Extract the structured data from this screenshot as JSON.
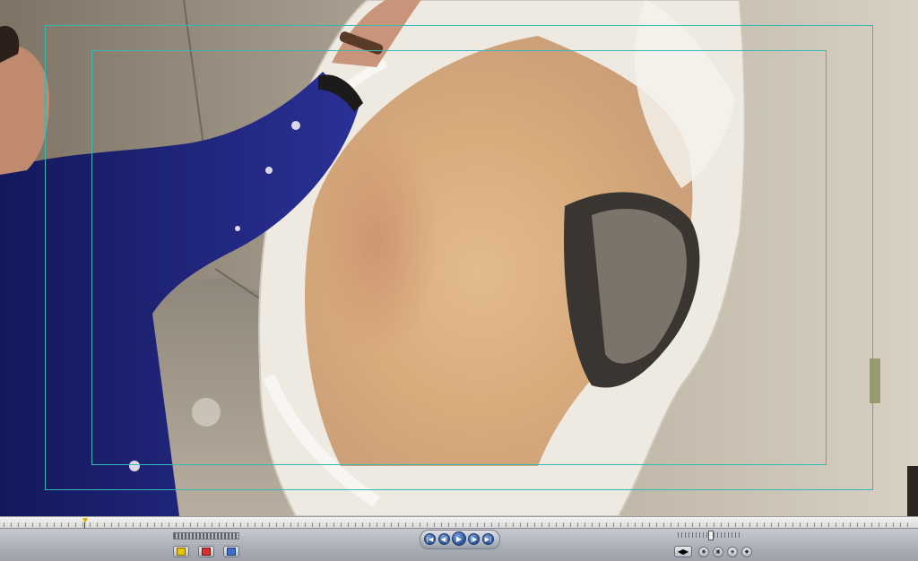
{
  "viewer": {
    "overlay": "title-action-safe"
  },
  "colors": {
    "safe_overlay": "#36b8b4",
    "playhead": "#d8b400",
    "transport_blue": "#2a4f94",
    "mark_in_yellow": "#e8c400",
    "mark_clip_red": "#d8322e",
    "match_frame_blue": "#3b6fd0"
  },
  "icons": {
    "play": "▶",
    "prev_edit": "|◀",
    "next_edit": "▶|",
    "in_point": "◀|",
    "out_point": "|▶",
    "mark_in": "mark-in-icon",
    "mark_clip": "mark-clip-icon",
    "match_frame": "match-frame-icon",
    "insert": "◀▶",
    "overwrite": "◉",
    "replace": "▣",
    "fit": "◈",
    "audio": "◆"
  }
}
